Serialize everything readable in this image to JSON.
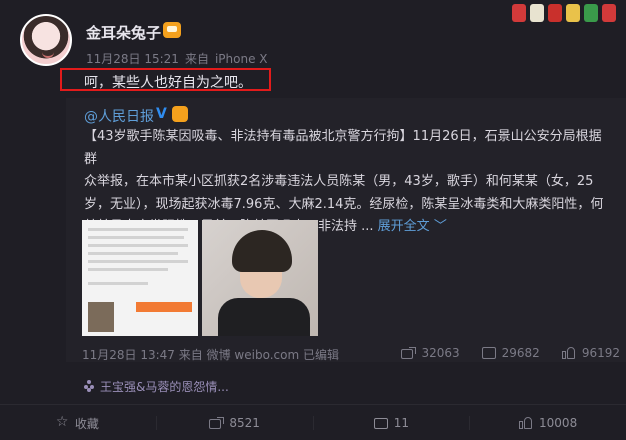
{
  "header": {
    "username": "金耳朵兔子",
    "time": "11月28日 15:21",
    "from_prefix": "来自",
    "client": "iPhone X"
  },
  "post": {
    "text": "呵，某些人也好自为之吧。"
  },
  "quoted": {
    "author": "@人民日报",
    "verified_mark": "V",
    "body_lines": [
      "【43岁歌手陈某因吸毒、非法持有毒品被北京警方行拘】11月26日，石景山公安分局根据群",
      "众举报，在本市某小区抓获2名涉毒违法人员陈某（男，43岁，歌手）和何某某（女，25",
      "岁，无业），现场起获冰毒7.96克、大麻2.14克。经尿检，陈某呈冰毒类和大麻类阳性，何",
      "某某呈大麻类阳性。目前，陈某因吸毒、非法持 ..."
    ],
    "expand_label": "展开全文",
    "expand_chevron": "﹀",
    "time": "11月28日 13:47",
    "from_prefix": "来自",
    "client": "微博 weibo.com",
    "edited": "已编辑",
    "reposts": "32063",
    "comments": "29682",
    "likes": "96192"
  },
  "topic": {
    "label": "王宝强&马蓉的恩怨情..."
  },
  "bottom_bar": {
    "collect": "收藏",
    "repost": "8521",
    "comment": "11",
    "like": "10008"
  },
  "colors": {
    "highlight_box": "#e21b1b",
    "link": "#5f9ed8",
    "background": "#1f1e25"
  }
}
